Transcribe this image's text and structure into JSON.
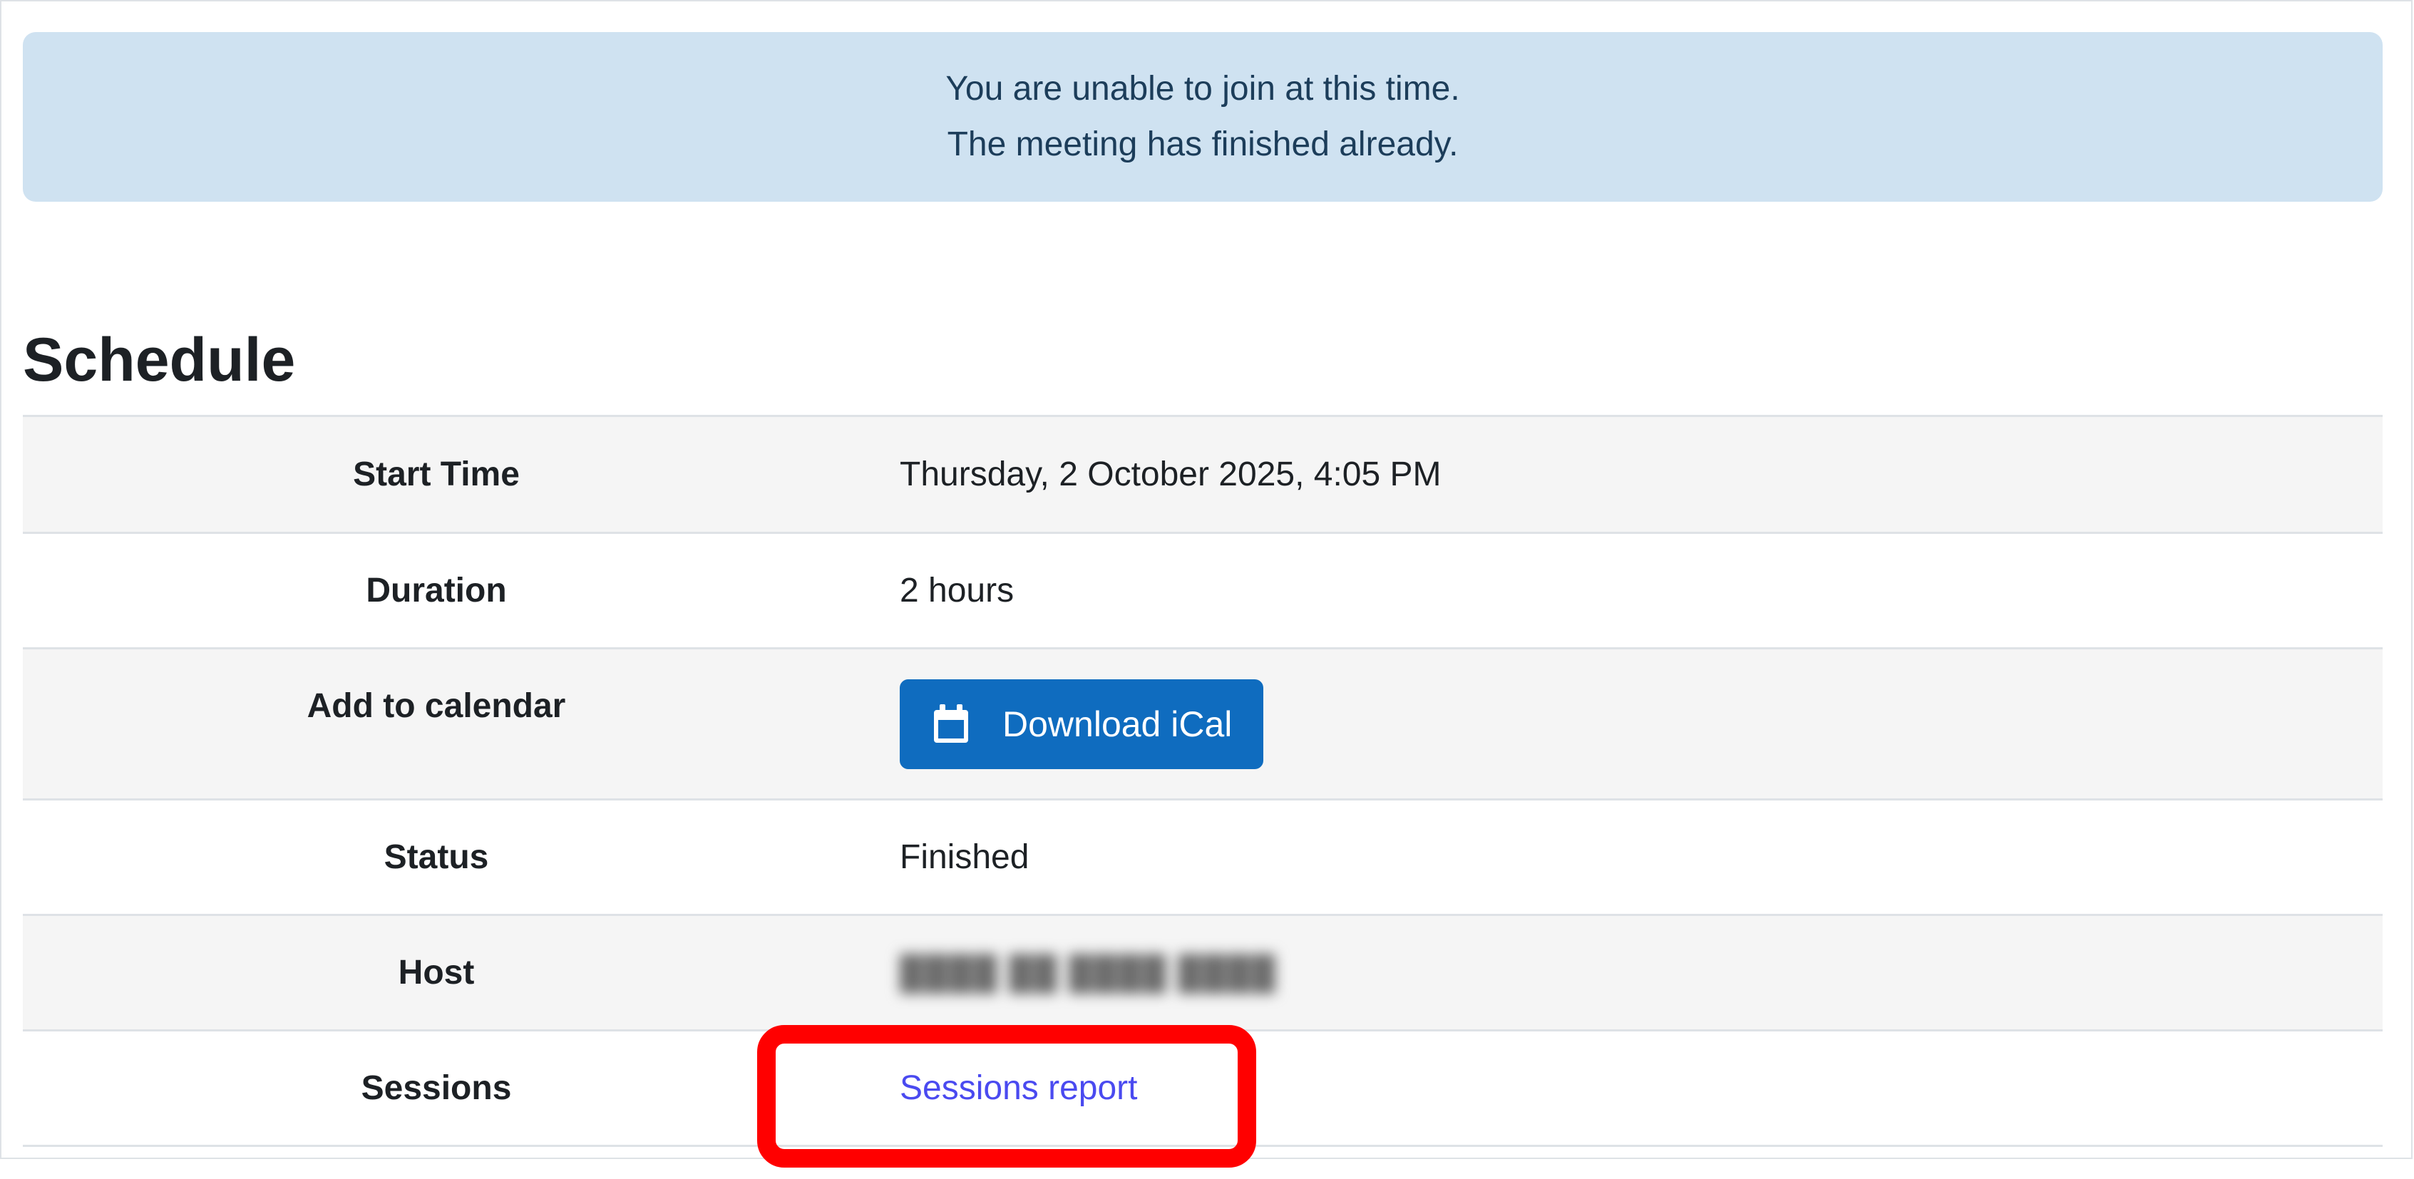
{
  "alert": {
    "line1": "You are unable to join at this time.",
    "line2": "The meeting has finished already."
  },
  "schedule": {
    "title": "Schedule",
    "rows": [
      {
        "label": "Start Time",
        "value": "Thursday, 2 October 2025, 4:05 PM"
      },
      {
        "label": "Duration",
        "value": "2 hours"
      },
      {
        "label": "Add to calendar",
        "button_label": "Download iCal",
        "icon": "calendar-icon"
      },
      {
        "label": "Status",
        "value": "Finished"
      },
      {
        "label": "Host",
        "value": "",
        "redacted": true
      },
      {
        "label": "Sessions",
        "link_label": "Sessions report"
      }
    ]
  },
  "colors": {
    "alert_bg": "#cfe2f1",
    "button_bg": "#0f6cbf",
    "link": "#4a4af0",
    "highlight": "#ff0000"
  }
}
